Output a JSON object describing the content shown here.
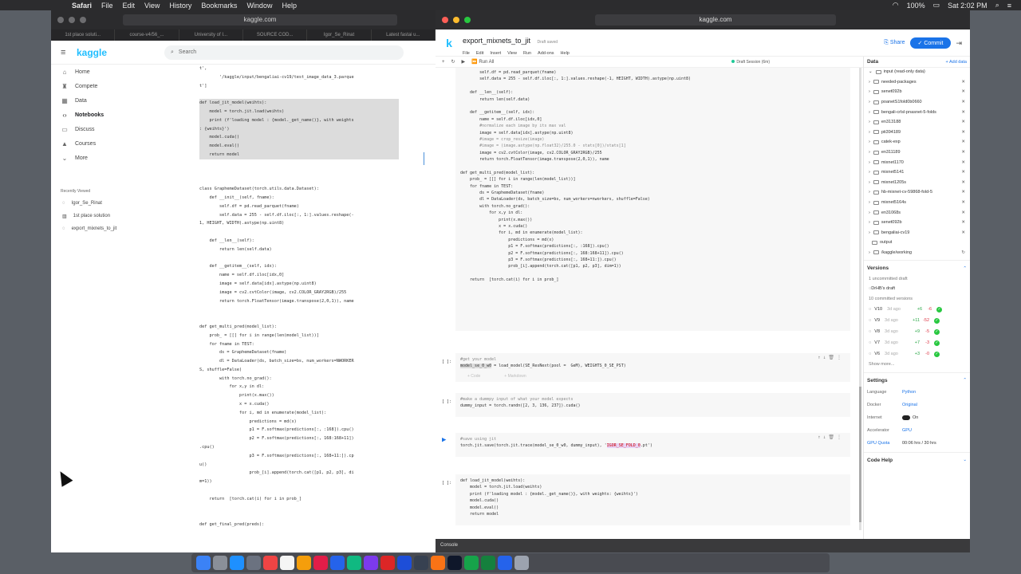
{
  "menubar": {
    "app": "Safari",
    "items": [
      "File",
      "Edit",
      "View",
      "History",
      "Bookmarks",
      "Window",
      "Help"
    ],
    "battery": "100%",
    "clock": "Sat 2:02 PM"
  },
  "left_window": {
    "url": "kaggle.com",
    "tabs": [
      "1st place soluti...",
      "course-v4/56_...",
      "University of I...",
      "SOURCE COD...",
      "Igor_Se_Rinat",
      "Latest fastai u..."
    ],
    "logo": "kaggle",
    "search_placeholder": "Search",
    "nav": [
      "Home",
      "Compete",
      "Data",
      "Notebooks",
      "Discuss",
      "Courses",
      "More"
    ],
    "recent_title": "Recently Viewed",
    "recent": [
      "Igor_Se_Rinat",
      "1st place solution",
      "export_mixnets_to_jit"
    ],
    "code": [
      "t',",
      "        '/kaggle/input/bengaliai-cv19/test_image_data_3.parque",
      "t']",
      "",
      "def load_jit_model(weihts):",
      "    model = torch.jit.load(weihts)",
      "    print (f'loading model : {model._get_name()}, with weights",
      ": {weihts}')",
      "    model.cuda()",
      "    model.eval()",
      "    return model",
      "",
      "",
      "",
      "class GraphemeDataset(torch.utils.data.Dataset):",
      "    def __init__(self, fname):",
      "        self.df = pd.read_parquet(fname)",
      "        self.data = 255 - self.df.iloc[:, 1:].values.reshape(-",
      "1, HEIGHT, WIDTH).astype(np.uint8)",
      "",
      "    def __len__(self):",
      "        return len(self.data)",
      "",
      "    def __getitem__(self, idx):",
      "        name = self.df.iloc[idx,0]",
      "        image = self.data[idx].astype(np.uint8)",
      "        image = cv2.cvtColor(image, cv2.COLOR_GRAY2RGB)/255",
      "        return torch.FloatTensor(image.transpose(2,0,1)), name",
      "",
      "",
      "def get_multi_pred(model_list):",
      "    prob_ = [[] for i in range(len(model_list))]",
      "    for fname in TEST:",
      "        ds = GraphemeDataset(fname)",
      "        dl = DataLoader(ds, batch_size=bs, num_workers=NWORKER",
      "S, shuffle=False)",
      "        with torch.no_grad():",
      "            for x,y in dl:",
      "                print(x.max())",
      "                x = x.cuda()",
      "                for i, md in enumerate(model_list):",
      "                    predictions = md(x)",
      "                    p1 = F.softmax(predictions[:, :168]).cpu()",
      "                    p2 = F.softmax(predictions[:, 168:168+11])",
      ".cpu()",
      "                    p3 = F.softmax(predictions[:, 168+11:]).cp",
      "u()",
      "                    prob_[i].append(torch.cat([p1, p2, p3], di",
      "m=1))",
      "",
      "    return  [torch.cat(i) for i in prob_]",
      "",
      "",
      "def get_final_pred(preds):"
    ]
  },
  "right_window": {
    "url": "kaggle.com",
    "title": "export_mixnets_to_jit",
    "saved": "Draft saved",
    "menu": [
      "File",
      "Edit",
      "Insert",
      "View",
      "Run",
      "Add-ons",
      "Help"
    ],
    "share": "Share",
    "commit": "Commit",
    "run_all": "Run All",
    "session": "Draft Session (6m)",
    "big_cell": [
      "        self.df = pd.read_parquet(fname)",
      "        self.data = 255 - self.df.iloc[:, 1:].values.reshape(-1, HEIGHT, WIDTH).astype(np.uint8)",
      "",
      "    def __len__(self):",
      "        return len(self.data)",
      "",
      "    def __getitem__(self, idx):",
      "        name = self.df.iloc[idx,0]",
      "        #normalize each image by its max val",
      "        image = self.data[idx].astype(np.uint8)",
      "        #image = crop_resize(image)",
      "        #image = (image.astype(np.float32)/255.0 - stats[0])/stats[1]",
      "        image = cv2.cvtColor(image, cv2.COLOR_GRAY2RGB)/255",
      "        return torch.FloatTensor(image.transpose(2,0,1)), name",
      "",
      "def get_multi_pred(model_list):",
      "    prob_ = [[] for i in range(len(model_list))]",
      "    for fname in TEST:",
      "        ds = GraphemeDataset(fname)",
      "        dl = DataLoader(ds, batch_size=bs, num_workers=nworkers, shuffle=False)",
      "        with torch.no_grad():",
      "            for x,y in dl:",
      "                print(x.max())",
      "                x = x.cuda()",
      "                for i, md in enumerate(model_list):",
      "                    predictions = md(x)",
      "                    p1 = F.softmax(predictions[:, :168]).cpu()",
      "                    p2 = F.softmax(predictions[:, 168:168+11]).cpu()",
      "                    p3 = F.softmax(predictions[:, 168+11:]).cpu()",
      "                    prob_[i].append(torch.cat([p1, p2, p3], dim=1))",
      "",
      "    return  [torch.cat(i) for i in prob_]"
    ],
    "prompt": "[ ]:",
    "cell2_comment": "#get your model",
    "cell2_code_a": "model_se_0_w0",
    "cell2_code_b": " = load_model(SE_ResNext(pool =  GeM), WEIGHTS_0_SE_PST)",
    "add_code": "+ Code",
    "add_markdown": "+ Markdown",
    "cell3_comment": "#make a dummpy input of what your model expects",
    "cell3_code": "dummy_input = torch.randn([2, 3, 136, 237]).cuda()",
    "cell4_comment": "#save using jit",
    "cell4_code_a": "torch.jit.save(torch.jit.trace(model_se_0_w0, dummy_input), '",
    "cell4_code_hl": "IGOR_SE_FOLD_0",
    "cell4_code_b": ".pt')",
    "cell5": [
      "def load_jit_model(weihts):",
      "    model = torch.jit.load(weihts)",
      "    print (f'loading model : {model._get_name()}, with weights: {weihts}')",
      "    model.cuda()",
      "    model.eval()",
      "    return model"
    ],
    "console": "Console",
    "panel": {
      "data_title": "Data",
      "add_data": "+ Add data",
      "input_label": "input (read-only data)",
      "datasets": [
        "needed-packages",
        "senet092b",
        "poanetS1fold0b0660",
        "bengali-crlsl-pnasnet-5-folds",
        "en313188",
        "pti394189",
        "catek-exp",
        "en311189",
        "mixnet1170",
        "mixnet5141",
        "mixnet1205s",
        "hb-mixnet-cv-59868-fold-5",
        "mixnet5164s",
        "en31068s",
        "senet092b",
        "bengaliai-cv19"
      ],
      "output_label": "output",
      "working": "/kaggle/working",
      "versions_title": "Versions",
      "uncommitted": "1 uncommitted draft",
      "draft": "DrHB's draft",
      "committed": "10 committed versions",
      "versions": [
        {
          "v": "V10",
          "age": "3d ago",
          "plus": "+6",
          "minus": "-6"
        },
        {
          "v": "V9",
          "age": "3d ago",
          "plus": "+11",
          "minus": "-52"
        },
        {
          "v": "V8",
          "age": "3d ago",
          "plus": "+9",
          "minus": "-5"
        },
        {
          "v": "V7",
          "age": "3d ago",
          "plus": "+7",
          "minus": "-3"
        },
        {
          "v": "V6",
          "age": "3d ago",
          "plus": "+3",
          "minus": "-0"
        }
      ],
      "show_more": "Show more...",
      "settings_title": "Settings",
      "settings": [
        {
          "label": "Language",
          "value": "Python"
        },
        {
          "label": "Docker",
          "value": "Original"
        },
        {
          "label": "Internet",
          "value": "On"
        },
        {
          "label": "Accelerator",
          "value": "GPU"
        }
      ],
      "gpu_quota_label": "GPU Quota",
      "gpu_quota": "00:06 hrs / 30 hrs",
      "code_help": "Code Help"
    }
  }
}
